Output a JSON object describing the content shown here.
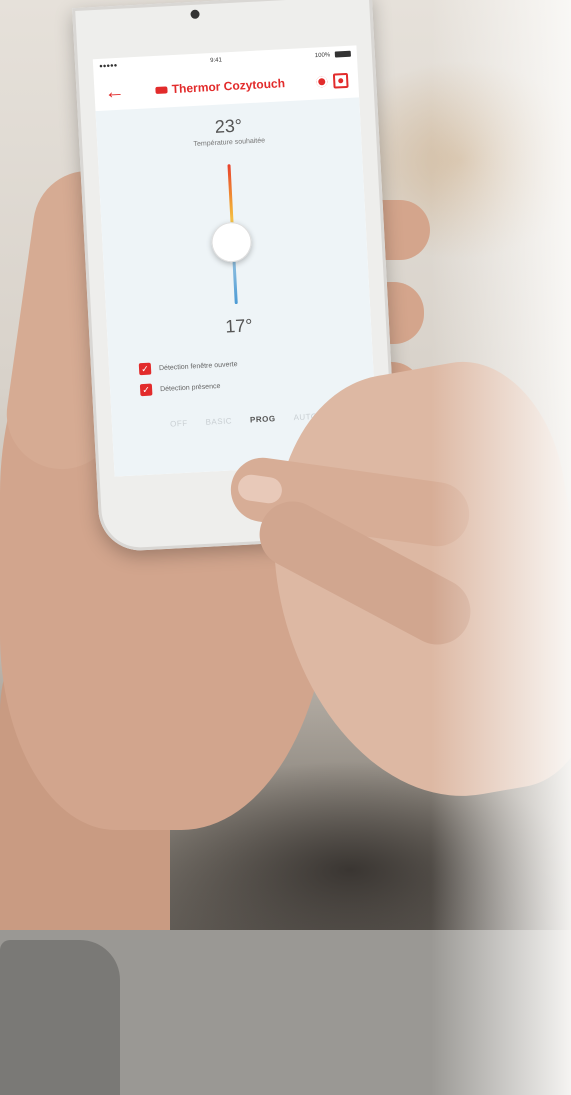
{
  "status_bar": {
    "carrier": "●●●●● ",
    "time": "9:41",
    "battery": "100%"
  },
  "header": {
    "back_icon": "arrow-left-icon",
    "brand": "Thermor Cozytouch",
    "settings_icon": "gear-icon",
    "scan_icon": "scan-icon"
  },
  "thermostat": {
    "max_temp": "23°",
    "caption": "Température souhaitée",
    "min_temp": "17°"
  },
  "options": [
    {
      "label": "Détection fenêtre ouverte",
      "checked": true
    },
    {
      "label": "Détection présence",
      "checked": true
    }
  ],
  "modes": [
    {
      "label": "OFF",
      "active": false
    },
    {
      "label": "BASIC",
      "active": false
    },
    {
      "label": "PROG",
      "active": true
    },
    {
      "label": "AUTO",
      "active": false
    }
  ],
  "colors": {
    "accent": "#e22b2b",
    "screen_bg": "#eef4f7"
  }
}
